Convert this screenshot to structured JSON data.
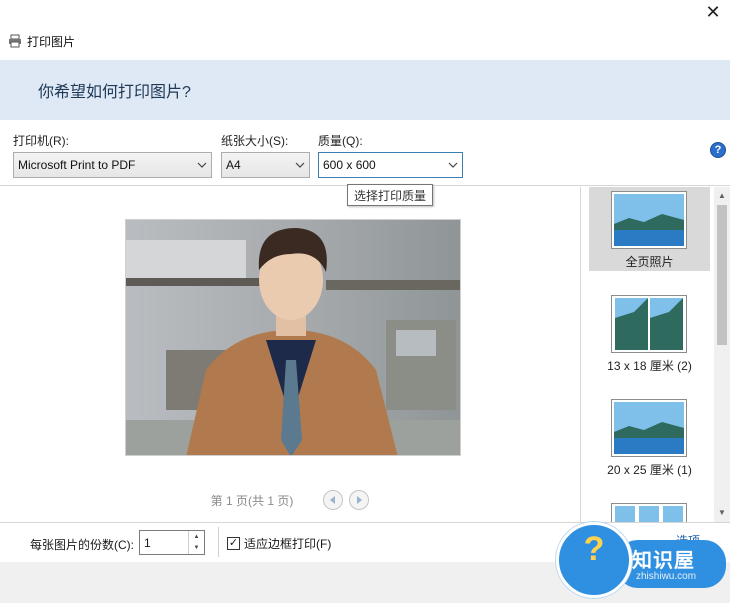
{
  "window": {
    "title": "打印图片",
    "close_glyph": "✕"
  },
  "header": {
    "question": "你希望如何打印图片?"
  },
  "settings": {
    "printer": {
      "label": "打印机(R):",
      "value": "Microsoft Print to PDF"
    },
    "paper": {
      "label": "纸张大小(S):",
      "value": "A4"
    },
    "quality": {
      "label": "质量(Q):",
      "value": "600 x 600",
      "tooltip": "选择打印质量"
    },
    "help_glyph": "?"
  },
  "preview": {
    "page_text": "第 1 页(共 1 页)"
  },
  "layouts": [
    {
      "caption": "全页照片",
      "selected": true
    },
    {
      "caption": "13 x 18 厘米 (2)",
      "selected": false
    },
    {
      "caption": "20 x 25 厘米 (1)",
      "selected": false
    },
    {
      "caption": "",
      "selected": false
    }
  ],
  "bottom": {
    "copies_label": "每张图片的份数(C):",
    "copies_value": "1",
    "fit_label": "适应边框打印(F)",
    "fit_checked": true,
    "options_label": "选项..."
  },
  "watermark": {
    "brand": "知识屋",
    "url": "zhishiwu.com",
    "glyph": "?"
  },
  "colors": {
    "accent": "#2f8fe0",
    "banner": "#dfe9f5",
    "link": "#1f5fa8"
  }
}
